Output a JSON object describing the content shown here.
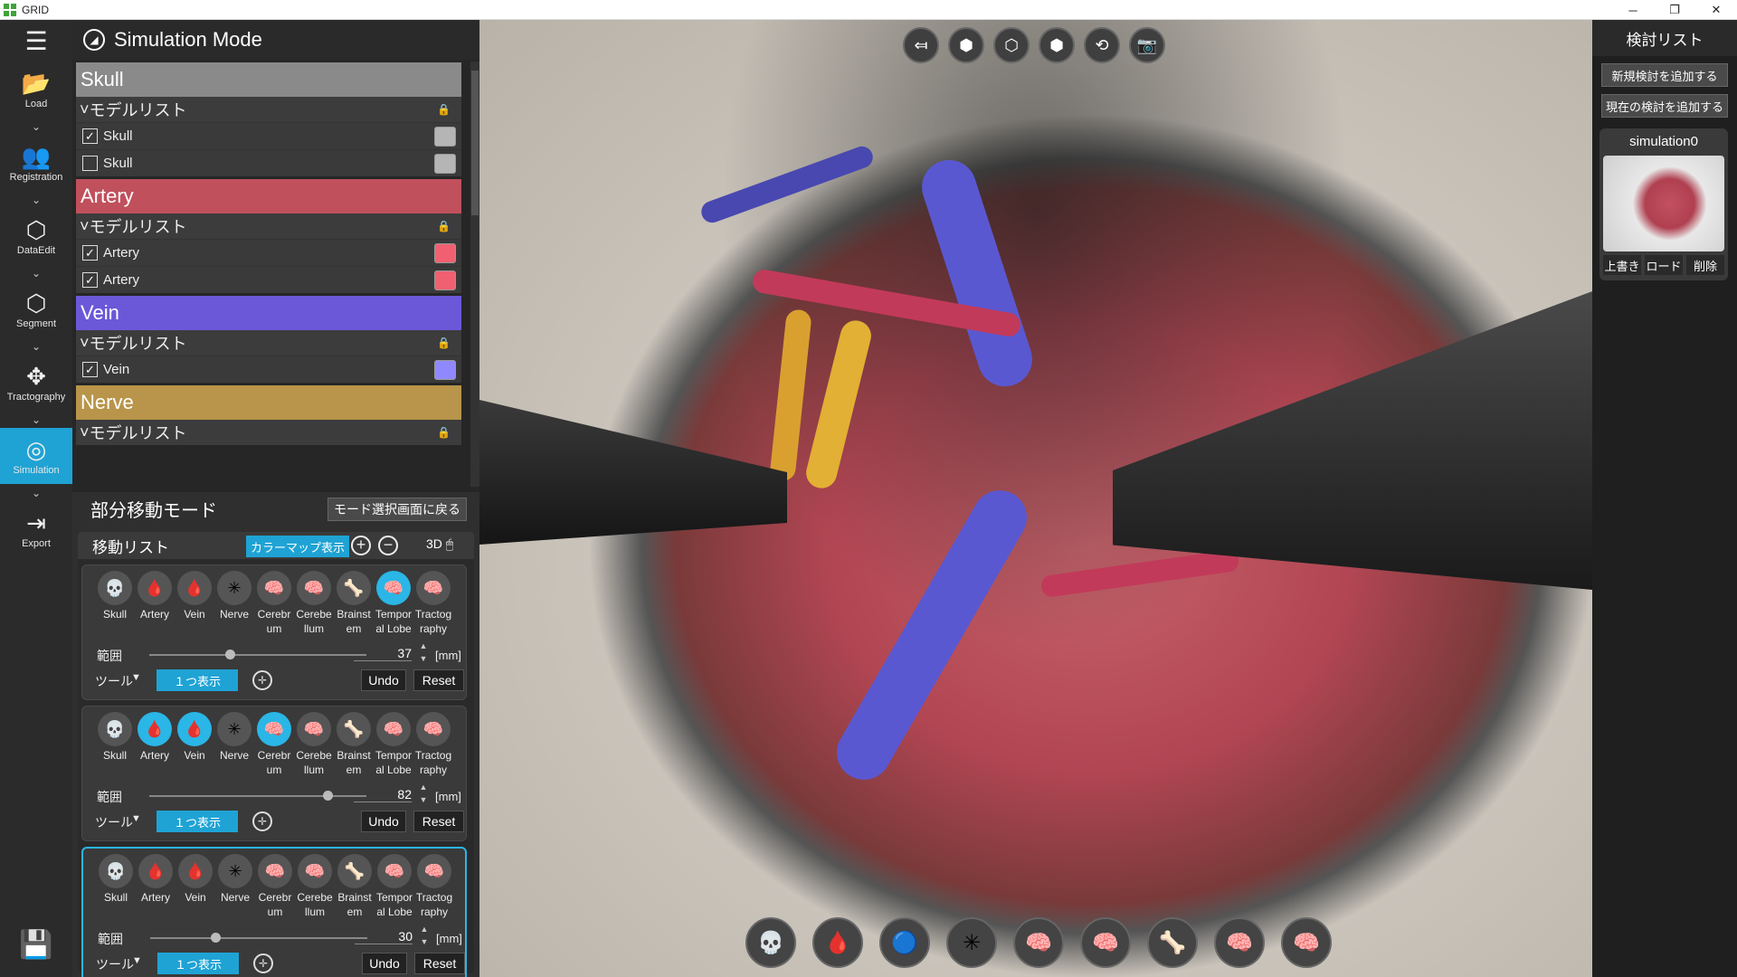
{
  "window": {
    "title": "GRID",
    "min": "─",
    "restore": "❐",
    "close": "✕"
  },
  "nav": {
    "menu": "☰",
    "items": [
      {
        "label": "Load",
        "icon": "folder-icon",
        "glyph": "📂"
      },
      {
        "label": "Registration",
        "icon": "people-icon",
        "glyph": "👥"
      },
      {
        "label": "DataEdit",
        "icon": "cube-edit-icon",
        "glyph": "⬡"
      },
      {
        "label": "Segment",
        "icon": "hexagon-icon",
        "glyph": "⬡"
      },
      {
        "label": "Tractography",
        "icon": "move-arrows-icon",
        "glyph": "✥"
      },
      {
        "label": "Simulation",
        "icon": "compass-icon",
        "glyph": "◎"
      },
      {
        "label": "Export",
        "icon": "export-icon",
        "glyph": "⇥"
      }
    ],
    "chevron": "⌄",
    "save_glyph": "💾"
  },
  "panel": {
    "title": "Simulation Mode",
    "groups": [
      {
        "title": "Skull",
        "color": "#8a8a8a",
        "model_list": "モデルリスト",
        "rows": [
          {
            "label": "Skull",
            "checked": true,
            "swatch": "#b5b5b5"
          },
          {
            "label": "Skull",
            "checked": false,
            "swatch": "#b5b5b5"
          }
        ]
      },
      {
        "title": "Artery",
        "color": "#c0505c",
        "model_list": "モデルリスト",
        "rows": [
          {
            "label": "Artery",
            "checked": true,
            "swatch": "#f06070"
          },
          {
            "label": "Artery",
            "checked": true,
            "swatch": "#f06070"
          }
        ]
      },
      {
        "title": "Vein",
        "color": "#6a58d8",
        "model_list": "モデルリスト",
        "rows": [
          {
            "label": "Vein",
            "checked": true,
            "swatch": "#8f88ff"
          }
        ]
      },
      {
        "title": "Nerve",
        "color": "#b8954a",
        "model_list": "モデルリスト",
        "rows": []
      }
    ],
    "mode_title": "部分移動モード",
    "back_button": "モード選択画面に戻る",
    "move_list": {
      "title": "移動リスト",
      "colormap_button": "カラーマップ表示",
      "add": "+",
      "remove": "−",
      "view3d": "3D",
      "organ_labels": [
        "Skull",
        "Artery",
        "Vein",
        "Nerve",
        "Cerebr um",
        "Cerebe llum",
        "Brainst em",
        "Tempor al Lobe",
        "Tractog raphy"
      ],
      "organ_glyphs": [
        "💀",
        "🩸",
        "🩸",
        "✳",
        "🧠",
        "🧠",
        "🦴",
        "🧠",
        "🧠"
      ],
      "range_label": "範囲",
      "unit": "[mm]",
      "tool_label": "ツール",
      "show_one": "１つ表示",
      "undo": "Undo",
      "reset": "Reset",
      "cards": [
        {
          "range": 37,
          "slider_fraction": 0.37,
          "active": [
            false,
            false,
            false,
            false,
            false,
            false,
            false,
            true,
            false
          ],
          "selected": false
        },
        {
          "range": 82,
          "slider_fraction": 0.82,
          "active": [
            false,
            true,
            true,
            false,
            true,
            false,
            false,
            false,
            false
          ],
          "selected": false
        },
        {
          "range": 30,
          "slider_fraction": 0.3,
          "active": [
            false,
            false,
            false,
            false,
            false,
            false,
            false,
            false,
            false
          ],
          "selected": true
        }
      ]
    }
  },
  "viewport": {
    "top_tools": [
      {
        "name": "back-view-icon",
        "glyph": "⤆"
      },
      {
        "name": "cube-front-icon",
        "glyph": "⬢"
      },
      {
        "name": "cube-left-icon",
        "glyph": "⬡"
      },
      {
        "name": "cube-right-icon",
        "glyph": "⬢"
      },
      {
        "name": "reset-camera-icon",
        "glyph": "⟲"
      },
      {
        "name": "camera-icon",
        "glyph": "📷"
      }
    ],
    "bottom_models": [
      {
        "name": "skull-model-icon",
        "glyph": "💀"
      },
      {
        "name": "artery-model-icon",
        "glyph": "🩸"
      },
      {
        "name": "vein-model-icon",
        "glyph": "🔵"
      },
      {
        "name": "nerve-model-icon",
        "glyph": "✳"
      },
      {
        "name": "cerebrum-model-icon",
        "glyph": "🧠"
      },
      {
        "name": "cerebellum-model-icon",
        "glyph": "🧠"
      },
      {
        "name": "brainstem-model-icon",
        "glyph": "🦴"
      },
      {
        "name": "temporal-lobe-model-icon",
        "glyph": "🧠"
      },
      {
        "name": "tractography-model-icon",
        "glyph": "🧠"
      }
    ]
  },
  "review": {
    "title": "検討リスト",
    "add_new": "新規検討を追加する",
    "add_current": "現在の検討を追加する",
    "simulation": {
      "name": "simulation0",
      "overwrite": "上書き",
      "load": "ロード",
      "delete": "削除"
    }
  }
}
